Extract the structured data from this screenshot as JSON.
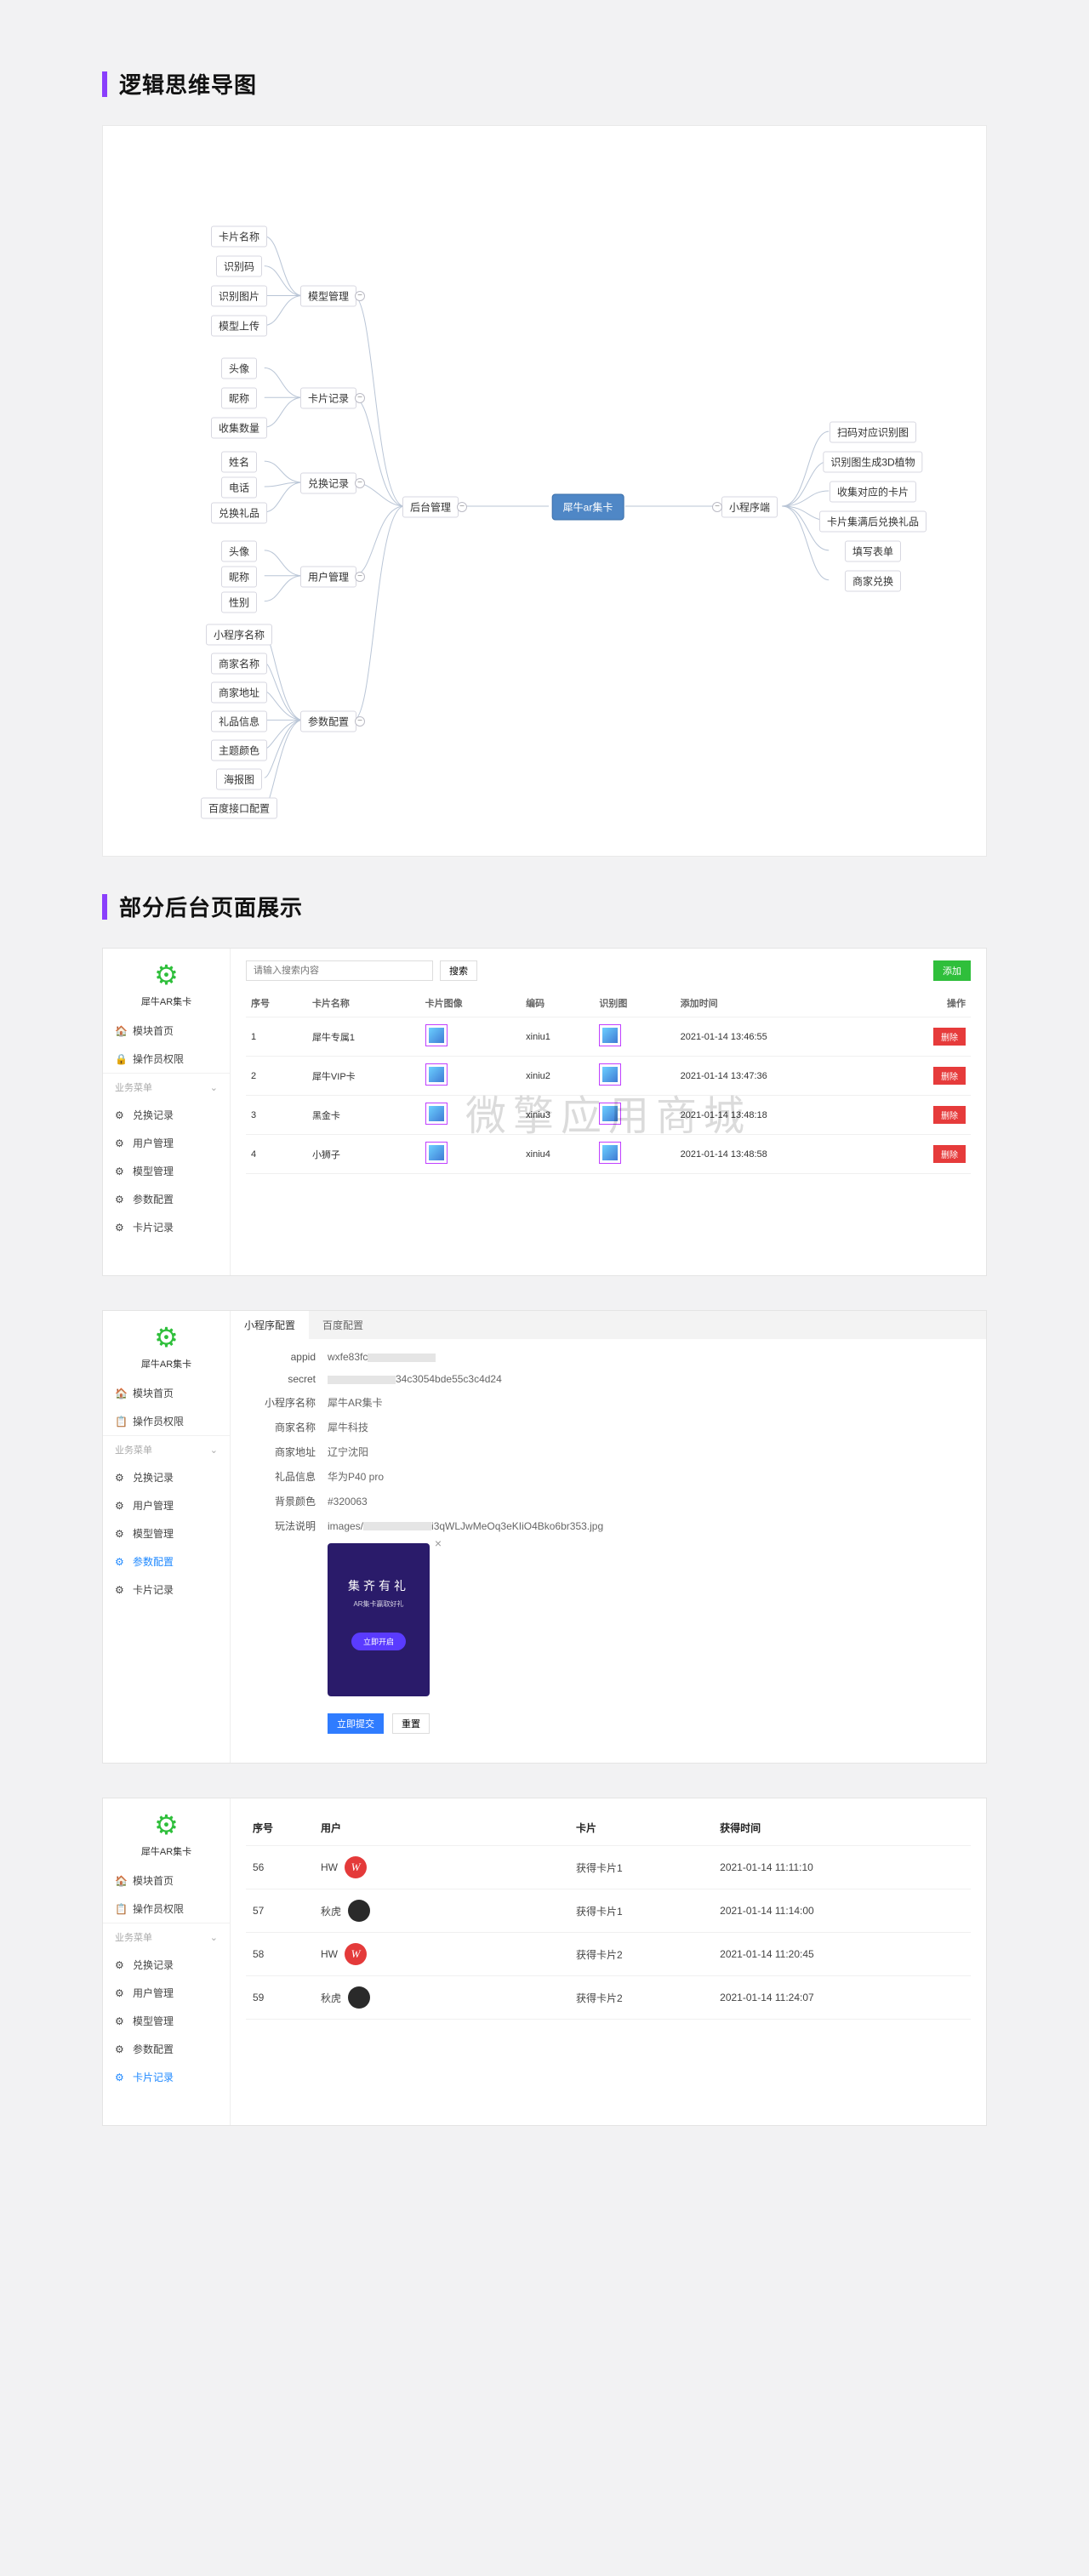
{
  "sections": {
    "mindmap_title": "逻辑思维导图",
    "admin_title": "部分后台页面展示"
  },
  "mindmap": {
    "root": "犀牛ar集卡",
    "backend": "后台管理",
    "mini": "小程序端",
    "sub": {
      "model_mgmt": "模型管理",
      "card_rec": "卡片记录",
      "redeem_rec": "兑换记录",
      "user_mgmt": "用户管理",
      "param_cfg": "参数配置"
    },
    "leaves": {
      "card_name": "卡片名称",
      "rec_code": "识别码",
      "rec_img": "识别图片",
      "model_up": "模型上传",
      "avatar": "头像",
      "nick": "昵称",
      "coll_count": "收集数量",
      "real_name": "姓名",
      "phone": "电话",
      "redeem_gift": "兑换礼品",
      "avatar2": "头像",
      "nick2": "昵称",
      "gender": "性别",
      "mini_name": "小程序名称",
      "merch_name": "商家名称",
      "merch_addr": "商家地址",
      "gift_info": "礼品信息",
      "theme_color": "主题颜色",
      "poster": "海报图",
      "baidu_cfg": "百度接口配置",
      "scan_img": "扫码对应识别图",
      "gen_3d": "识别图生成3D植物",
      "coll_card": "收集对应的卡片",
      "full_redeem": "卡片集满后兑换礼品",
      "fill_form": "填写表单",
      "merch_redeem": "商家兑换"
    }
  },
  "watermark": "微擎应用商城",
  "side": {
    "brand": "犀牛AR集卡",
    "home": "模块首页",
    "perm": "操作员权限",
    "group": "业务菜单",
    "redeem": "兑换记录",
    "user": "用户管理",
    "model": "模型管理",
    "param": "参数配置",
    "card": "卡片记录"
  },
  "cardlist": {
    "search_ph": "请输入搜索内容",
    "search_btn": "搜索",
    "add_btn": "添加",
    "cols": {
      "id": "序号",
      "name": "卡片名称",
      "img": "卡片图像",
      "code": "编码",
      "rec": "识别图",
      "time": "添加时间",
      "op": "操作"
    },
    "del": "删除",
    "rows": [
      {
        "id": "1",
        "name": "犀牛专属1",
        "code": "xiniu1",
        "time": "2021-01-14 13:46:55"
      },
      {
        "id": "2",
        "name": "犀牛VIP卡",
        "code": "xiniu2",
        "time": "2021-01-14 13:47:36"
      },
      {
        "id": "3",
        "name": "黑金卡",
        "code": "xiniu3",
        "time": "2021-01-14 13:48:18"
      },
      {
        "id": "4",
        "name": "小狮子",
        "code": "xiniu4",
        "time": "2021-01-14 13:48:58"
      }
    ]
  },
  "config": {
    "tab_mini": "小程序配置",
    "tab_baidu": "百度配置",
    "labels": {
      "appid": "appid",
      "secret": "secret",
      "mini_name": "小程序名称",
      "merch_name": "商家名称",
      "merch_addr": "商家地址",
      "gift": "礼品信息",
      "theme": "背景颜色",
      "rules": "玩法说明"
    },
    "vals": {
      "appid_prefix": "wxfe83fc",
      "secret_suffix": "34c3054bde55c3c4d24",
      "mini_name": "犀牛AR集卡",
      "merch_name": "犀牛科技",
      "merch_addr": "辽宁沈阳",
      "gift": "华为P40 pro",
      "theme": "#320063",
      "rules_prefix": "images/",
      "rules_suffix": "i3qWLJwMeOq3eKIiO4Bko6br353.jpg"
    },
    "poster_line1": "集齐有礼",
    "submit": "立即提交",
    "reset": "重置"
  },
  "records": {
    "cols": {
      "id": "序号",
      "user": "用户",
      "card": "卡片",
      "time": "获得时间"
    },
    "rows": [
      {
        "id": "56",
        "uname": "HW",
        "av": "W",
        "avcls": "av-red",
        "card": "获得卡片1",
        "time": "2021-01-14 11:11:10"
      },
      {
        "id": "57",
        "uname": "秋虎",
        "av": "",
        "avcls": "av-dark",
        "card": "获得卡片1",
        "time": "2021-01-14 11:14:00"
      },
      {
        "id": "58",
        "uname": "HW",
        "av": "W",
        "avcls": "av-red",
        "card": "获得卡片2",
        "time": "2021-01-14 11:20:45"
      },
      {
        "id": "59",
        "uname": "秋虎",
        "av": "",
        "avcls": "av-dark",
        "card": "获得卡片2",
        "time": "2021-01-14 11:24:07"
      }
    ]
  }
}
